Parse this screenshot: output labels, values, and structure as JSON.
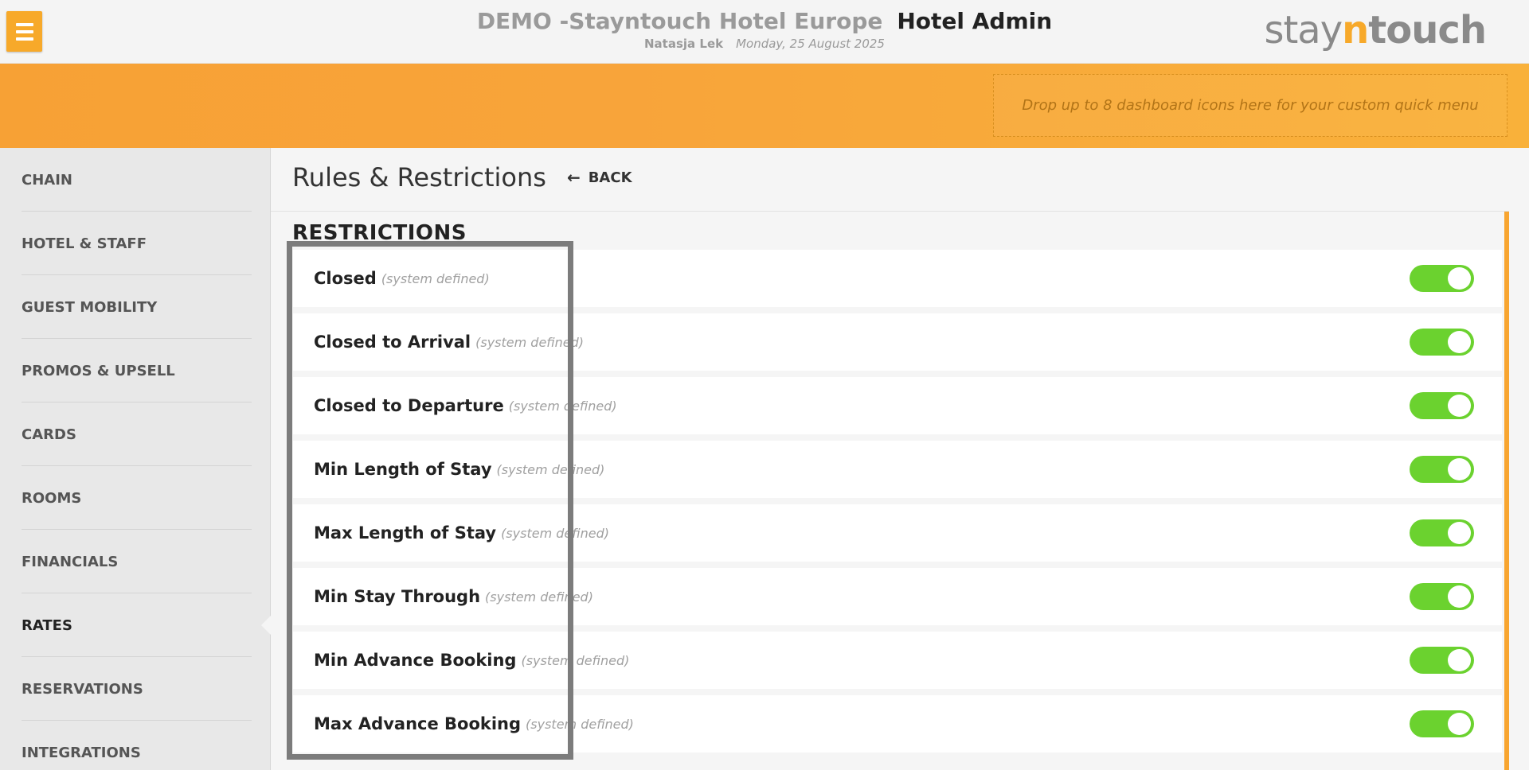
{
  "header": {
    "hotel_name": "DEMO -Stayntouch Hotel Europe",
    "app_name": "Hotel Admin",
    "user": "Natasja Lek",
    "date": "Monday, 25 August 2025",
    "logo": {
      "part1": "stay",
      "part2": "n",
      "part3": "touch"
    }
  },
  "banner": {
    "quick_menu_placeholder": "Drop up to 8 dashboard icons here for your custom quick menu"
  },
  "sidebar": {
    "items": [
      {
        "label": "CHAIN"
      },
      {
        "label": "HOTEL & STAFF"
      },
      {
        "label": "GUEST MOBILITY"
      },
      {
        "label": "PROMOS & UPSELL"
      },
      {
        "label": "CARDS"
      },
      {
        "label": "ROOMS"
      },
      {
        "label": "FINANCIALS"
      },
      {
        "label": "RATES"
      },
      {
        "label": "RESERVATIONS"
      },
      {
        "label": "INTEGRATIONS"
      }
    ],
    "active": "RATES"
  },
  "main": {
    "title": "Rules & Restrictions",
    "back_label": "BACK",
    "section_title": "RESTRICTIONS",
    "restrictions": [
      {
        "name": "Closed",
        "note": "(system defined)",
        "enabled": true
      },
      {
        "name": "Closed to Arrival",
        "note": "(system defined)",
        "enabled": true
      },
      {
        "name": "Closed to Departure",
        "note": "(system defined)",
        "enabled": true
      },
      {
        "name": "Min Length of Stay",
        "note": "(system defined)",
        "enabled": true
      },
      {
        "name": "Max Length of Stay",
        "note": "(system defined)",
        "enabled": true
      },
      {
        "name": "Min Stay Through",
        "note": "(system defined)",
        "enabled": true
      },
      {
        "name": "Min Advance Booking",
        "note": "(system defined)",
        "enabled": true
      },
      {
        "name": "Max Advance Booking",
        "note": "(system defined)",
        "enabled": true
      }
    ]
  },
  "colors": {
    "accent": "#f7a92a",
    "toggle_on": "#6bd22f"
  }
}
